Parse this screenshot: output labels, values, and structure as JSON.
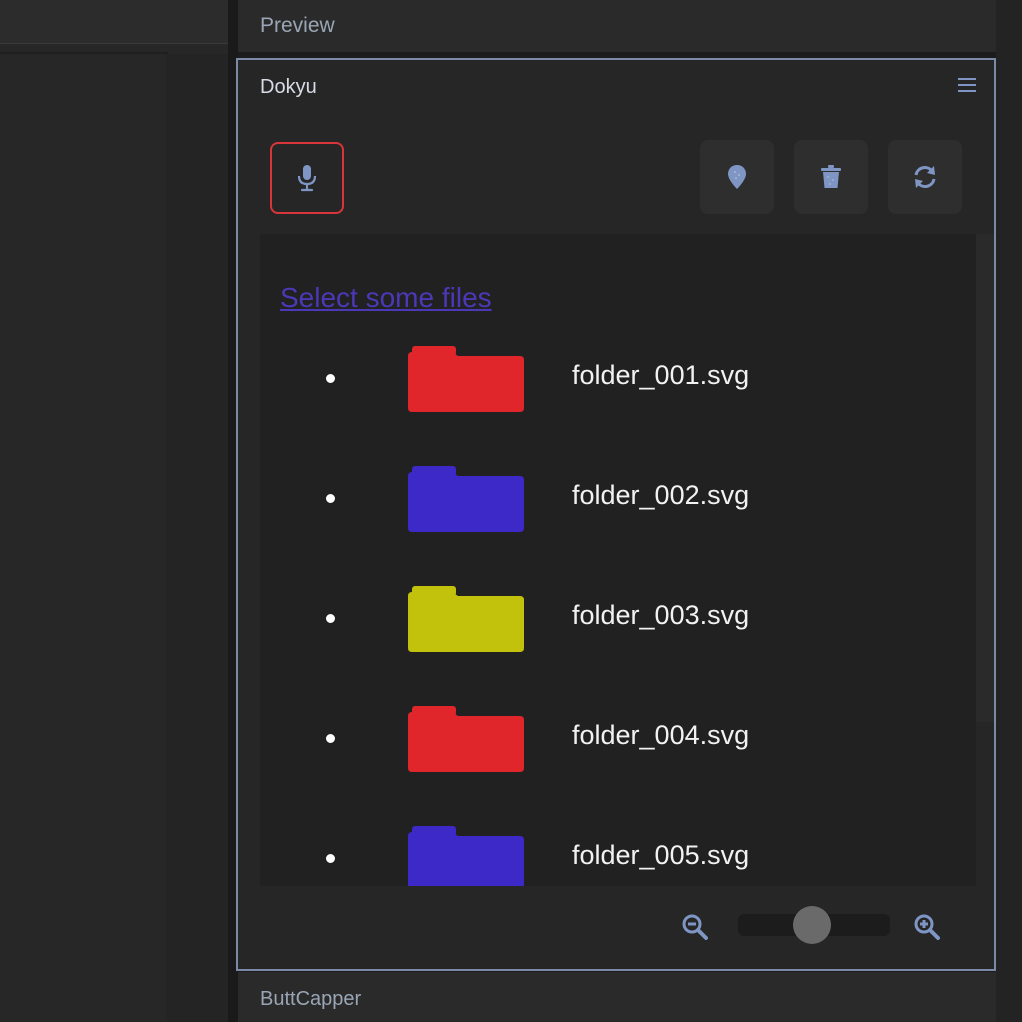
{
  "preview": {
    "title": "Preview"
  },
  "panel": {
    "title": "Dokyu",
    "toolbar": {
      "mic_icon": "microphone-icon",
      "pin_icon": "map-pin-icon",
      "trash_icon": "trash-icon",
      "refresh_icon": "refresh-icon"
    },
    "select_link": "Select some files",
    "files": [
      {
        "name": "folder_001.svg",
        "color": "#e0262a"
      },
      {
        "name": "folder_002.svg",
        "color": "#3d28c8"
      },
      {
        "name": "folder_003.svg",
        "color": "#c2c20c"
      },
      {
        "name": "folder_004.svg",
        "color": "#e0262a"
      },
      {
        "name": "folder_005.svg",
        "color": "#3d28c8"
      }
    ],
    "zoom": {
      "level": 0.49
    }
  },
  "footer": {
    "title": "ButtCapper"
  },
  "colors": {
    "accent_border": "#7b8aa6",
    "mic_border": "#d8353a",
    "icon": "#7f96c4"
  }
}
